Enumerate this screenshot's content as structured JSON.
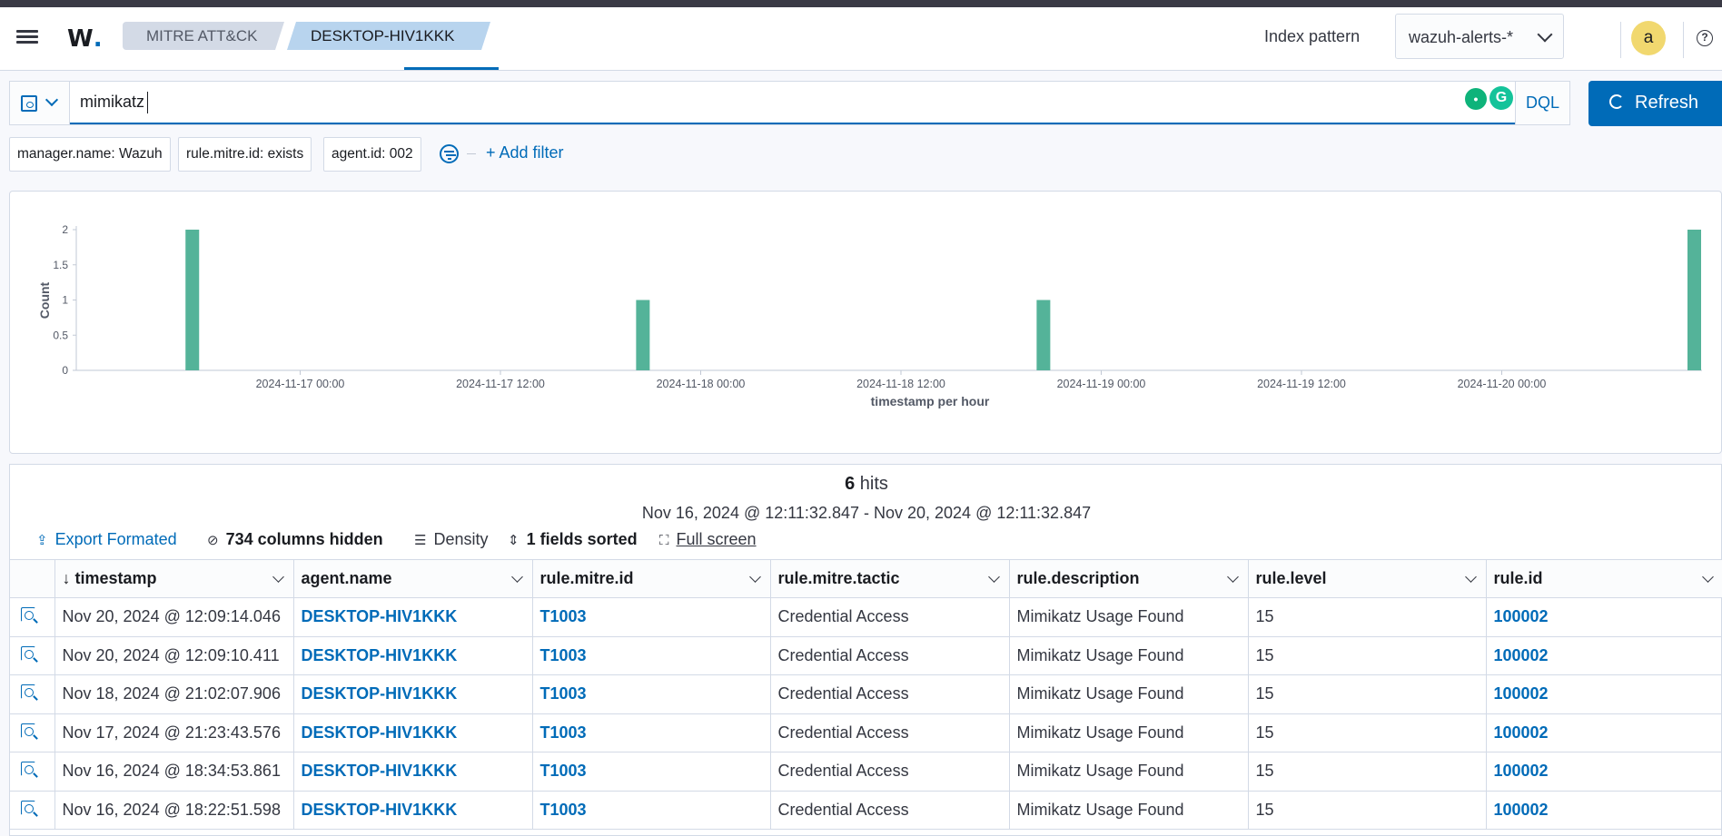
{
  "header": {
    "breadcrumbs": [
      "MITRE ATT&CK",
      "DESKTOP-HIV1KKK"
    ],
    "index_pattern_label": "Index pattern",
    "index_pattern_value": "wazuh-alerts-*",
    "avatar_letter": "a",
    "help_glyph": "?"
  },
  "query": {
    "value": "mimikatz",
    "language": "DQL",
    "refresh_label": "Refresh"
  },
  "filters": [
    "manager.name: Wazuh",
    "rule.mitre.id: exists",
    "agent.id: 002"
  ],
  "add_filter_label": "+ Add filter",
  "chart_data": {
    "type": "bar",
    "xlabel": "timestamp per hour",
    "ylabel": "Count",
    "ylim": [
      0,
      2
    ],
    "yticks": [
      "0",
      "0.5",
      "1",
      "1.5",
      "2"
    ],
    "xticks": [
      "2024-11-17 00:00",
      "2024-11-17 12:00",
      "2024-11-18 00:00",
      "2024-11-18 12:00",
      "2024-11-19 00:00",
      "2024-11-19 12:00",
      "2024-11-20 00:00"
    ],
    "x_range": [
      "2024-11-16 12:00",
      "2024-11-20 12:00"
    ],
    "bars": [
      {
        "x": "2024-11-16 18:00",
        "value": 2
      },
      {
        "x": "2024-11-17 21:00",
        "value": 1
      },
      {
        "x": "2024-11-18 21:00",
        "value": 1
      },
      {
        "x": "2024-11-20 12:00",
        "value": 2
      }
    ],
    "color": "#54b399"
  },
  "results": {
    "hits_count": "6",
    "hits_label": "hits",
    "time_range": "Nov 16, 2024 @ 12:11:32.847 - Nov 20, 2024 @ 12:11:32.847",
    "toolbar": {
      "export": "Export Formated",
      "columns_hidden": "734 columns hidden",
      "density": "Density",
      "sorted": "1 fields sorted",
      "fullscreen": "Full screen"
    },
    "columns": [
      "timestamp",
      "agent.name",
      "rule.mitre.id",
      "rule.mitre.tactic",
      "rule.description",
      "rule.level",
      "rule.id"
    ],
    "rows": [
      [
        "Nov 20, 2024 @ 12:09:14.046",
        "DESKTOP-HIV1KKK",
        "T1003",
        "Credential Access",
        "Mimikatz Usage Found",
        "15",
        "100002"
      ],
      [
        "Nov 20, 2024 @ 12:09:10.411",
        "DESKTOP-HIV1KKK",
        "T1003",
        "Credential Access",
        "Mimikatz Usage Found",
        "15",
        "100002"
      ],
      [
        "Nov 18, 2024 @ 21:02:07.906",
        "DESKTOP-HIV1KKK",
        "T1003",
        "Credential Access",
        "Mimikatz Usage Found",
        "15",
        "100002"
      ],
      [
        "Nov 17, 2024 @ 21:23:43.576",
        "DESKTOP-HIV1KKK",
        "T1003",
        "Credential Access",
        "Mimikatz Usage Found",
        "15",
        "100002"
      ],
      [
        "Nov 16, 2024 @ 18:34:53.861",
        "DESKTOP-HIV1KKK",
        "T1003",
        "Credential Access",
        "Mimikatz Usage Found",
        "15",
        "100002"
      ],
      [
        "Nov 16, 2024 @ 18:22:51.598",
        "DESKTOP-HIV1KKK",
        "T1003",
        "Credential Access",
        "Mimikatz Usage Found",
        "15",
        "100002"
      ]
    ]
  }
}
